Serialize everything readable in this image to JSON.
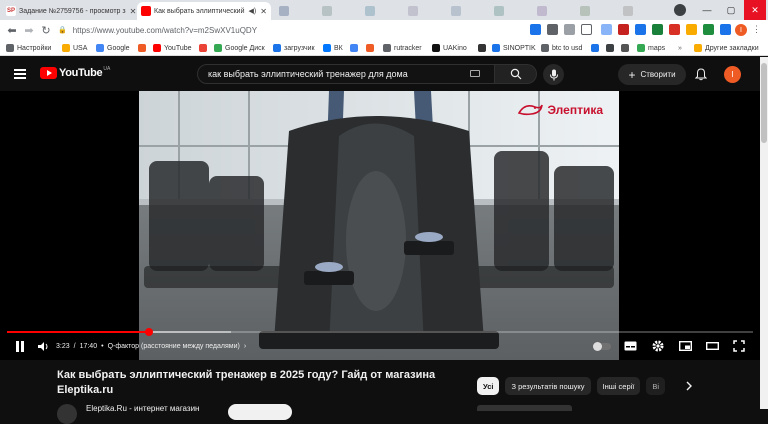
{
  "browser": {
    "tabs": [
      {
        "favicon_text": "SP",
        "title": "Задание №2759756 - просмотр з",
        "active": false
      },
      {
        "title": "Как выбрать эллиптический",
        "active": true
      }
    ],
    "url": "https://www.youtube.com/watch?v=m2SwXV1uQDY",
    "bookmarks": [
      "Настройки",
      "USA",
      "Google",
      "YouTube",
      "Google Диск",
      "загрузчик",
      "ВК",
      "rutracker",
      "UAKino",
      "SINOPTIK",
      "btc to usd",
      "maps",
      "Другие закладки"
    ],
    "profile_initial": "I"
  },
  "youtube": {
    "logo_text": "YouTube",
    "region": "UA",
    "search_query": "как выбрать эллиптический тренажер для дома",
    "create_label": "Створити",
    "avatar_initial": "I"
  },
  "player": {
    "watermark": "Элептика",
    "current_time": "3:23",
    "duration": "17:40",
    "time_separator": "/",
    "chapter": "Q-фактор (расстояние между педалями)",
    "progress_fraction": 0.19,
    "buffered_fraction": 0.3,
    "paused": false
  },
  "video": {
    "title": "Как выбрать эллиптический тренажер в 2025 году? Гайд от магазина Eleptika.ru",
    "channel": "Eleptika.Ru - интернет магазин"
  },
  "chips": [
    "Усі",
    "З результатів пошуку",
    "Інші серії",
    "Ві"
  ],
  "colors": {
    "brand_red": "#ff0000",
    "avatar": "#ef5b25",
    "background": "#0f0f0f"
  }
}
